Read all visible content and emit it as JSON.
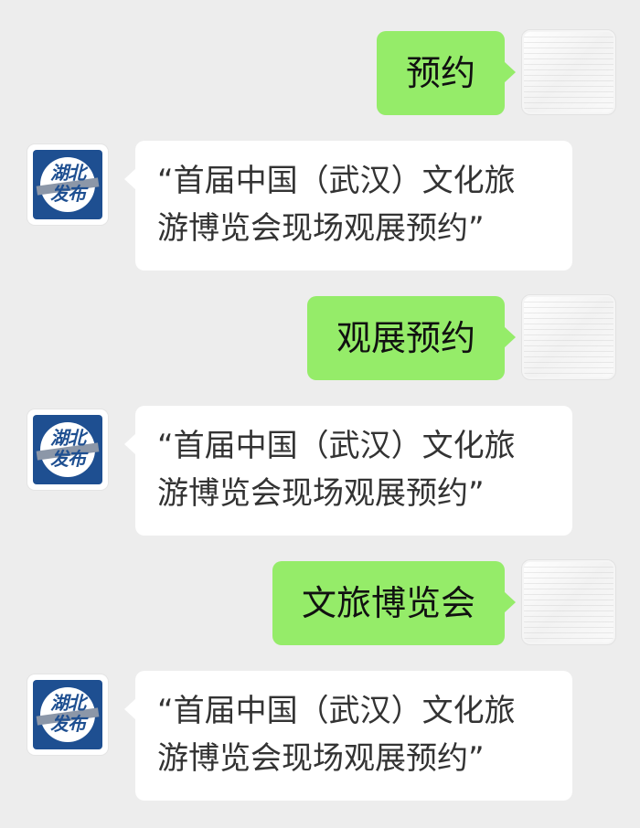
{
  "chat": {
    "contact_avatar": "湖北发布",
    "outgoing": [
      {
        "text": "预约"
      },
      {
        "text": "观展预约"
      },
      {
        "text": "文旅博览会"
      }
    ],
    "incoming": [
      {
        "text": "“首届中国（武汉）文化旅\n游博览会现场观展预约”"
      },
      {
        "text": "“首届中国（武汉）文化旅\n游博览会现场观展预约”"
      },
      {
        "text": "“首届中国（武汉）文化旅\n游博览会现场观展预约”"
      }
    ]
  },
  "colors": {
    "background": "#ededed",
    "outgoing_bubble": "#95ec69",
    "incoming_bubble": "#ffffff",
    "logo_blue": "#1e4f91"
  }
}
